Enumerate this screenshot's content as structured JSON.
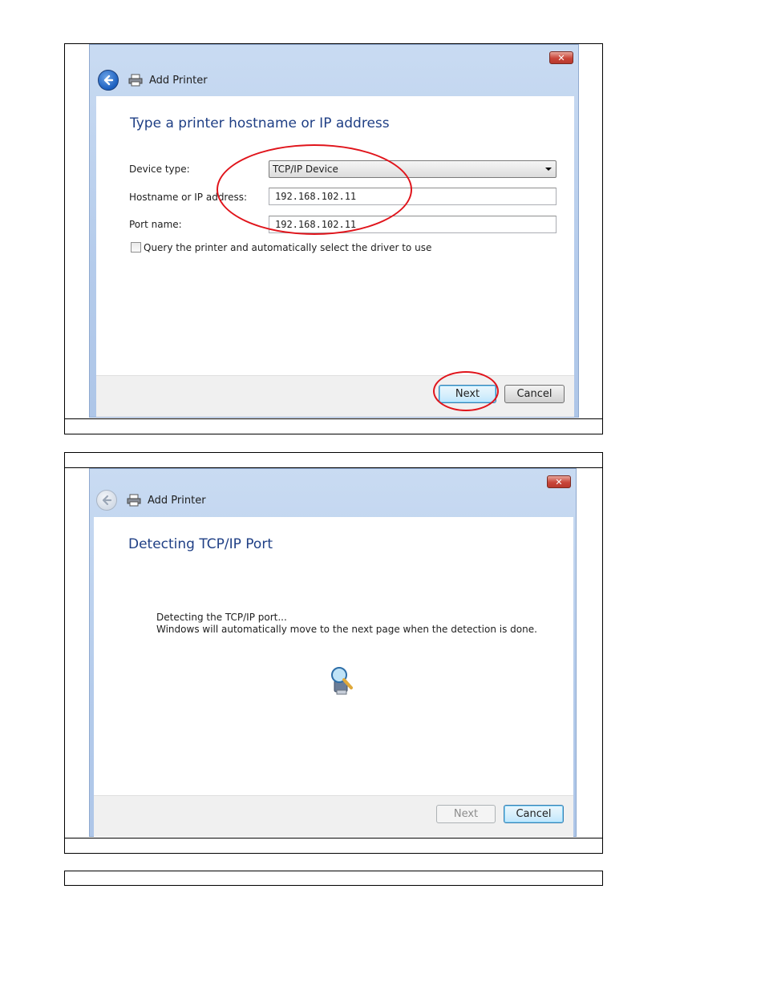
{
  "dialog1": {
    "title": "Add Printer",
    "heading": "Type a printer hostname or IP address",
    "device_type_label": "Device type:",
    "device_type_value": "TCP/IP Device",
    "hostname_label": "Hostname or IP address:",
    "hostname_value": "192.168.102.11",
    "port_label": "Port name:",
    "port_value": "192.168.102.11",
    "query_checkbox_label": "Query the printer and automatically select the driver to use",
    "query_checked": false,
    "next_label": "Next",
    "cancel_label": "Cancel",
    "close_glyph": "✕"
  },
  "dialog2": {
    "title": "Add Printer",
    "heading": "Detecting TCP/IP Port",
    "message_line1": "Detecting the TCP/IP port...",
    "message_line2": "Windows will automatically move to the next page when the detection is done.",
    "next_label": "Next",
    "cancel_label": "Cancel",
    "close_glyph": "✕"
  },
  "icons": {
    "back": "back-arrow-icon",
    "printer": "printer-icon",
    "close": "close-icon",
    "dropdown": "dropdown-arrow-icon",
    "search": "search-magnifier-icon"
  },
  "colors": {
    "heading": "#1f3f85",
    "annotation": "#e0141b",
    "titlebar": "#b4cbeb"
  }
}
